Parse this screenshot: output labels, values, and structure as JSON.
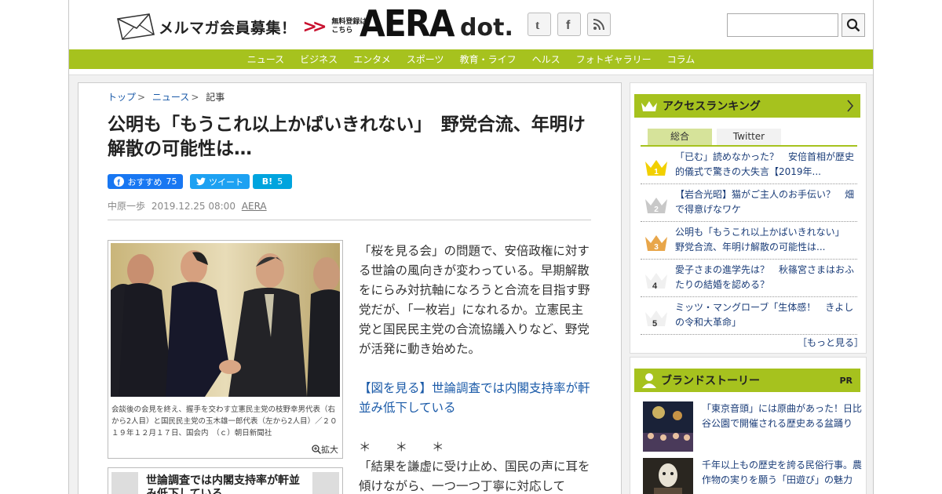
{
  "header": {
    "mail_banner": "メルマガ会員募集！",
    "free_register": [
      "無料登録は",
      "こちら"
    ],
    "logo_main": "AERA",
    "logo_sub": "dot.",
    "social": [
      "twitter-icon",
      "facebook-icon",
      "rss-icon"
    ],
    "search_placeholder": ""
  },
  "nav": {
    "items": [
      "ニュース",
      "ビジネス",
      "エンタメ",
      "スポーツ",
      "教育・ライフ",
      "ヘルス",
      "フォトギャラリー",
      "コラム"
    ]
  },
  "breadcrumb": {
    "top": "トップ",
    "news": "ニュース",
    "current": "記事"
  },
  "article": {
    "title": "公明も「もうこれ以上かばいきれない」　野党合流、年明け解散の可能性は…",
    "share": {
      "fb_label": "おすすめ",
      "fb_count": "75",
      "tweet_label": "ツイート",
      "hatena_label": "B!",
      "hatena_count": "5"
    },
    "author": "中原一歩",
    "date": "2019.12.25 08:00",
    "source": "AERA",
    "photo_caption": "会談後の会見を終え、握手を交わす立憲民主党の枝野幸男代表（右から2人目）と国民民主党の玉木雄一郎代表（左から2人目）／２０１９年１２月１７日、国会内　（ｃ）朝日新聞社",
    "zoom_label": "拡大",
    "related_title": "世論調査では内閣支持率が軒並み低下している",
    "para1": "「桜を見る会」の問題で、安倍政権に対する世論の風向きが変わっている。早期解散をにらみ対抗軸になろうと合流を目指す野党だが、「一枚岩」になれるか。立憲民主党と国民民主党の合流協議入りなど、野党が活発に動き始めた。",
    "link": "【図を見る】世論調査では内閣支持率が軒並み低下している",
    "stars": "＊　　＊　　＊",
    "para2": "「結果を謙虚に受け止め、国民の声に耳を傾けながら、一つ一つ丁寧に対応して"
  },
  "ranking": {
    "title": "アクセスランキング",
    "tabs": [
      "総合",
      "Twitter"
    ],
    "items": [
      {
        "rank": "1",
        "text": "「已む」読めなかった？　安倍首相が歴史的儀式で驚きの大失言【2019年..."
      },
      {
        "rank": "2",
        "text": "【岩合光昭】猫がご主人のお手伝い？　畑で得意げなワケ"
      },
      {
        "rank": "3",
        "text": "公明も「もうこれ以上かばいきれない」　野党合流、年明け解散の可能性は..."
      },
      {
        "rank": "4",
        "text": "愛子さまの進学先は？　秋篠宮さまはおふたりの結婚を認める？"
      },
      {
        "rank": "5",
        "text": "ミッツ・マングローブ「生体感！　きよしの令和大革命」"
      }
    ],
    "more": "［もっと見る］"
  },
  "brand": {
    "title": "ブランドストーリー",
    "pr": "PR",
    "items": [
      {
        "text": "「東京音頭」には原曲があった！日比谷公園で開催される歴史ある盆踊り"
      },
      {
        "text": "千年以上もの歴史を誇る民俗行事。農作物の実りを願う「田遊び」の魅力"
      }
    ]
  },
  "colors": {
    "brand_green": "#a6c21e",
    "link_blue": "#1a5aa8",
    "facebook": "#1877f2",
    "twitter": "#1da1f2",
    "hatena": "#00a4de"
  }
}
